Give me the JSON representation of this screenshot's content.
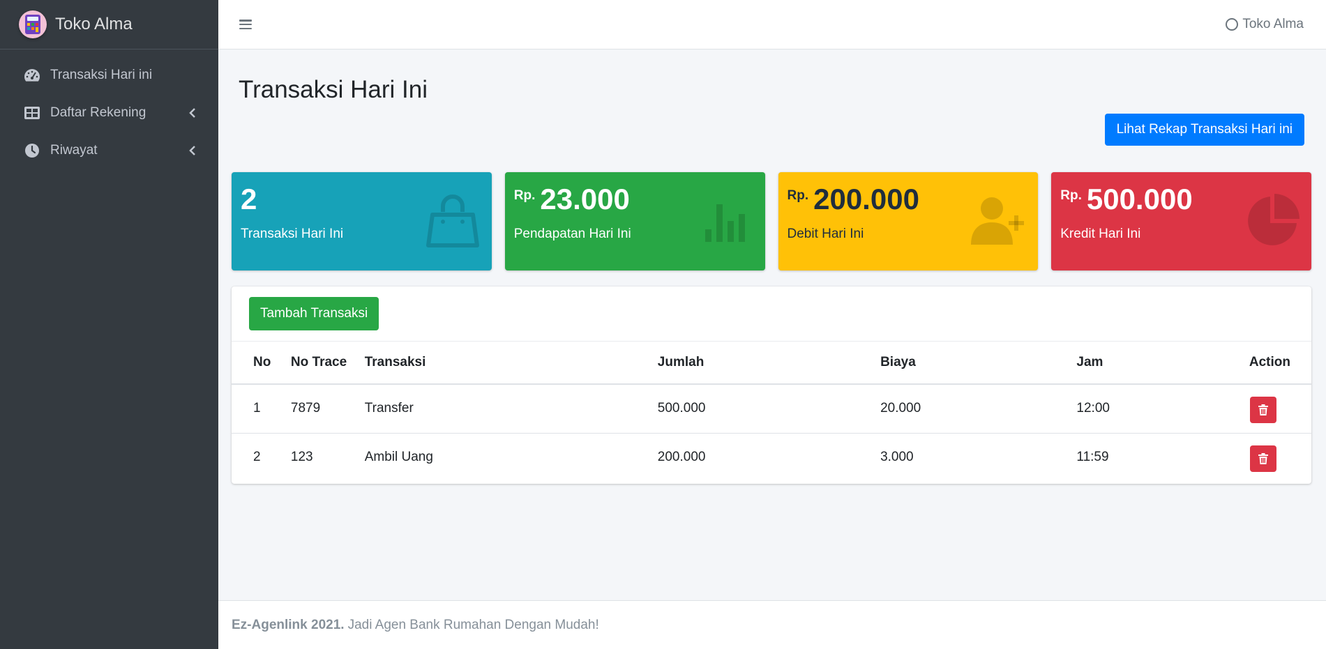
{
  "brand": {
    "name": "Toko Alma"
  },
  "sidebar": {
    "items": [
      {
        "label": "Transaksi Hari ini",
        "icon": "tachometer-icon",
        "has_children": false
      },
      {
        "label": "Daftar Rekening",
        "icon": "table-icon",
        "has_children": true
      },
      {
        "label": "Riwayat",
        "icon": "clock-icon",
        "has_children": true
      }
    ]
  },
  "topbar": {
    "user_label": "Toko Alma"
  },
  "page": {
    "title": "Transaksi Hari Ini",
    "rekap_button": "Lihat Rekap Transaksi Hari ini"
  },
  "boxes": [
    {
      "prefix": "",
      "value": "2",
      "label": "Transaksi Hari Ini",
      "color": "#17a2b8",
      "icon": "shopping-bag-icon"
    },
    {
      "prefix": "Rp.",
      "value": "23.000",
      "label": "Pendapatan Hari Ini",
      "color": "#28a745",
      "icon": "bar-chart-icon"
    },
    {
      "prefix": "Rp.",
      "value": "200.000",
      "label": "Debit Hari Ini",
      "color": "#ffc107",
      "icon": "user-plus-icon"
    },
    {
      "prefix": "Rp.",
      "value": "500.000",
      "label": "Kredit Hari Ini",
      "color": "#dc3545",
      "icon": "pie-chart-icon"
    }
  ],
  "table": {
    "add_button": "Tambah Transaksi",
    "columns": [
      "No",
      "No Trace",
      "Transaksi",
      "Jumlah",
      "Biaya",
      "Jam",
      "Action"
    ],
    "rows": [
      {
        "no": "1",
        "trace": "7879",
        "transaksi": "Transfer",
        "jumlah": "500.000",
        "biaya": "20.000",
        "jam": "12:00"
      },
      {
        "no": "2",
        "trace": "123",
        "transaksi": "Ambil Uang",
        "jumlah": "200.000",
        "biaya": "3.000",
        "jam": "11:59"
      }
    ]
  },
  "footer": {
    "brand": "Ez-Agenlink 2021.",
    "tagline": "Jadi Agen Bank Rumahan Dengan Mudah!"
  }
}
